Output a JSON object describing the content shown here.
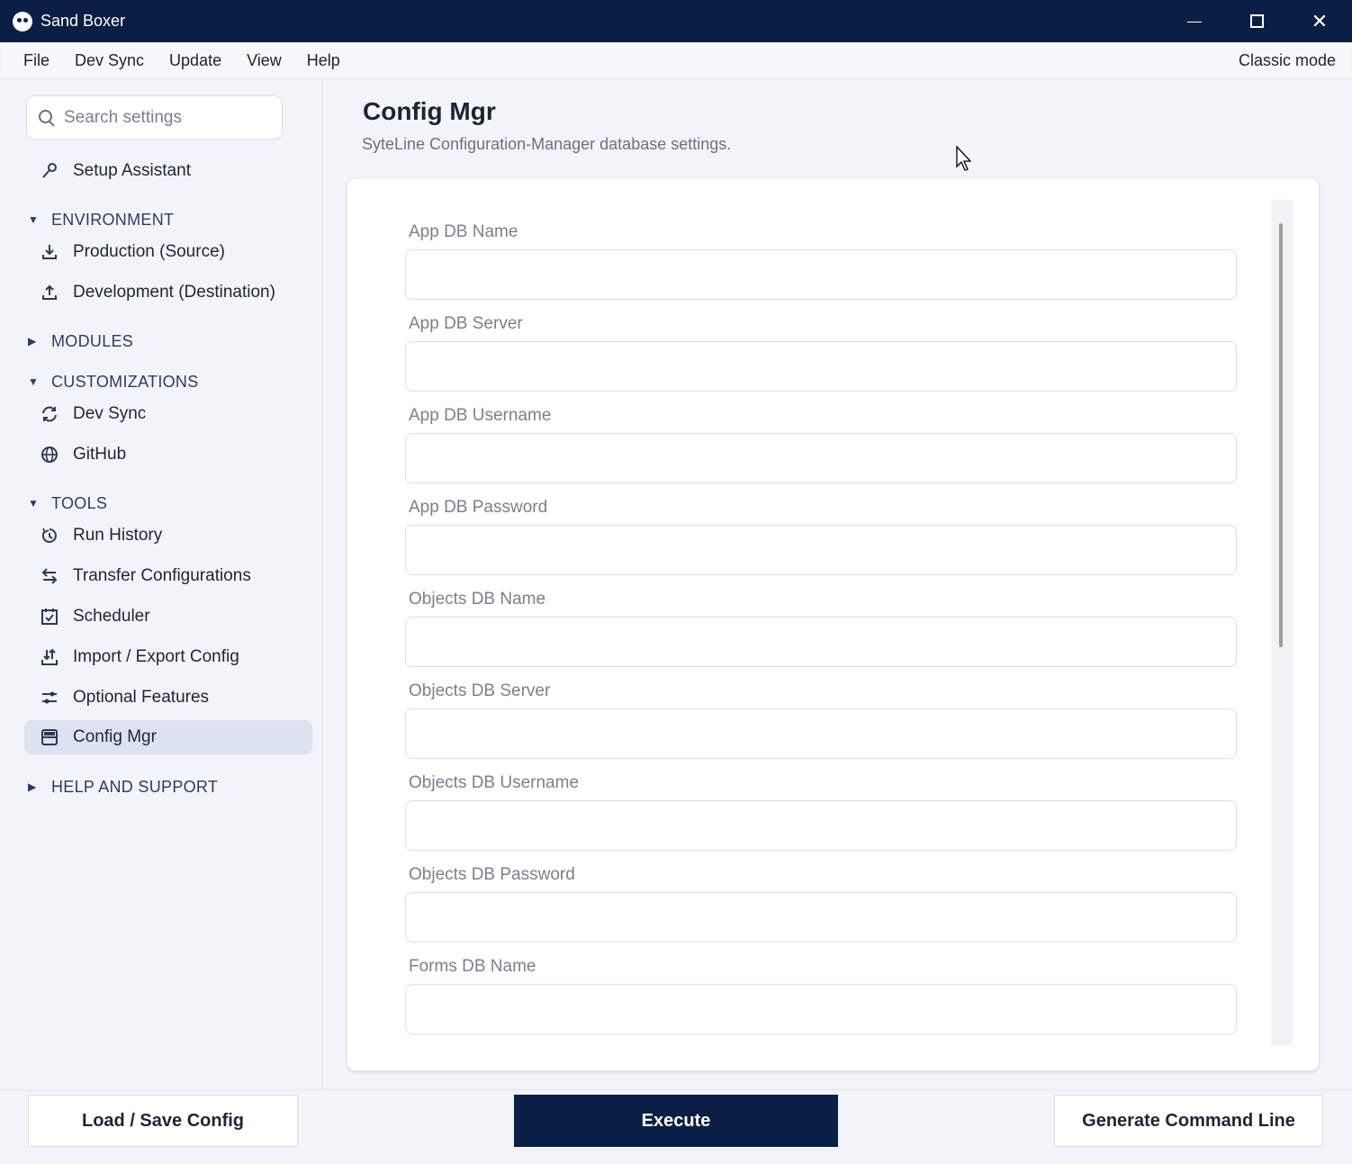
{
  "window": {
    "title": "Sand Boxer"
  },
  "menubar": {
    "items": [
      "File",
      "Dev Sync",
      "Update",
      "View",
      "Help"
    ],
    "classic_mode": "Classic mode"
  },
  "sidebar": {
    "search_placeholder": "Search settings",
    "setup_assistant": "Setup Assistant",
    "sections": {
      "environment": "ENVIRONMENT",
      "modules": "MODULES",
      "customizations": "CUSTOMIZATIONS",
      "tools": "TOOLS",
      "help": "HELP AND SUPPORT"
    },
    "environment_items": [
      "Production (Source)",
      "Development (Destination)"
    ],
    "customization_items": [
      "Dev Sync",
      "GitHub"
    ],
    "tools_items": [
      "Run History",
      "Transfer Configurations",
      "Scheduler",
      "Import / Export Config",
      "Optional Features",
      "Config Mgr"
    ],
    "active_item": "Config Mgr"
  },
  "main": {
    "title": "Config Mgr",
    "subtitle": "SyteLine Configuration-Manager database settings.",
    "fields": [
      {
        "label": "App DB Name",
        "value": ""
      },
      {
        "label": "App DB Server",
        "value": ""
      },
      {
        "label": "App DB Username",
        "value": ""
      },
      {
        "label": "App DB Password",
        "value": ""
      },
      {
        "label": "Objects DB Name",
        "value": ""
      },
      {
        "label": "Objects DB Server",
        "value": ""
      },
      {
        "label": "Objects DB Username",
        "value": ""
      },
      {
        "label": "Objects DB Password",
        "value": ""
      },
      {
        "label": "Forms DB Name",
        "value": ""
      }
    ]
  },
  "footer": {
    "load_save": "Load / Save Config",
    "execute": "Execute",
    "generate": "Generate Command Line"
  },
  "colors": {
    "navy": "#0b1f44",
    "active_bg": "#dde2f0",
    "section_text": "#2d3c63"
  }
}
